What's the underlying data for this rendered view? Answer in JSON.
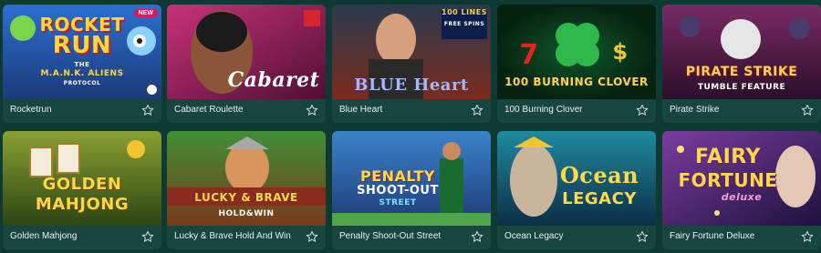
{
  "games": [
    {
      "title": "Rocketrun",
      "art": {
        "line1": "ROCKET",
        "line2": "RUN",
        "line3": "THE",
        "line4": "M.A.N.K. ALIENS",
        "line5": "PROTOCOL"
      },
      "badge": "NEW",
      "colors": [
        "#2d6fd1",
        "#1b3a7a"
      ]
    },
    {
      "title": "Cabaret Roulette",
      "art": {
        "line1": "Cabaret",
        "line2": "",
        "line3": "",
        "line4": "",
        "line5": ""
      },
      "colors": [
        "#c9317b",
        "#4e1034"
      ]
    },
    {
      "title": "Blue Heart",
      "art": {
        "line1": "BLUE Heart",
        "line2": "100 LINES",
        "line3": "FREE SPINS",
        "line4": "",
        "line5": ""
      },
      "colors": [
        "#2b3a4e",
        "#7b2b1d"
      ]
    },
    {
      "title": "100 Burning Clover",
      "art": {
        "line1": "100 BURNING CLOVER",
        "line2": "7",
        "line3": "$",
        "line4": "",
        "line5": ""
      },
      "colors": [
        "#0f5a2a",
        "#062311"
      ]
    },
    {
      "title": "Pirate Strike",
      "art": {
        "line1": "PIRATE STRIKE",
        "line2": "TUMBLE FEATURE",
        "line3": "",
        "line4": "",
        "line5": ""
      },
      "colors": [
        "#7a2a65",
        "#2b0f2a"
      ]
    },
    {
      "title": "Golden Mahjong",
      "art": {
        "line1": "GOLDEN",
        "line2": "MAHJONG",
        "line3": "",
        "line4": "",
        "line5": ""
      },
      "colors": [
        "#8aa032",
        "#2b4612"
      ]
    },
    {
      "title": "Lucky & Brave Hold And Win",
      "art": {
        "line1": "LUCKY & BRAVE",
        "line2": "HOLD&WIN",
        "line3": "",
        "line4": "",
        "line5": ""
      },
      "colors": [
        "#3f8f36",
        "#7a3b1a"
      ]
    },
    {
      "title": "Penalty Shoot-Out Street",
      "art": {
        "line1": "PENALTY",
        "line2": "SHOOT-OUT",
        "line3": "STREET",
        "line4": "",
        "line5": ""
      },
      "colors": [
        "#3a83c9",
        "#1f3a78"
      ]
    },
    {
      "title": "Ocean Legacy",
      "art": {
        "line1": "Ocean",
        "line2": "LEGACY",
        "line3": "",
        "line4": "",
        "line5": ""
      },
      "colors": [
        "#1f8aa0",
        "#0b2f45"
      ]
    },
    {
      "title": "Fairy Fortune Deluxe",
      "art": {
        "line1": "FAIRY",
        "line2": "FORTUNE",
        "line3": "deluxe",
        "line4": "",
        "line5": ""
      },
      "colors": [
        "#7b3d9f",
        "#1d123d"
      ]
    }
  ]
}
